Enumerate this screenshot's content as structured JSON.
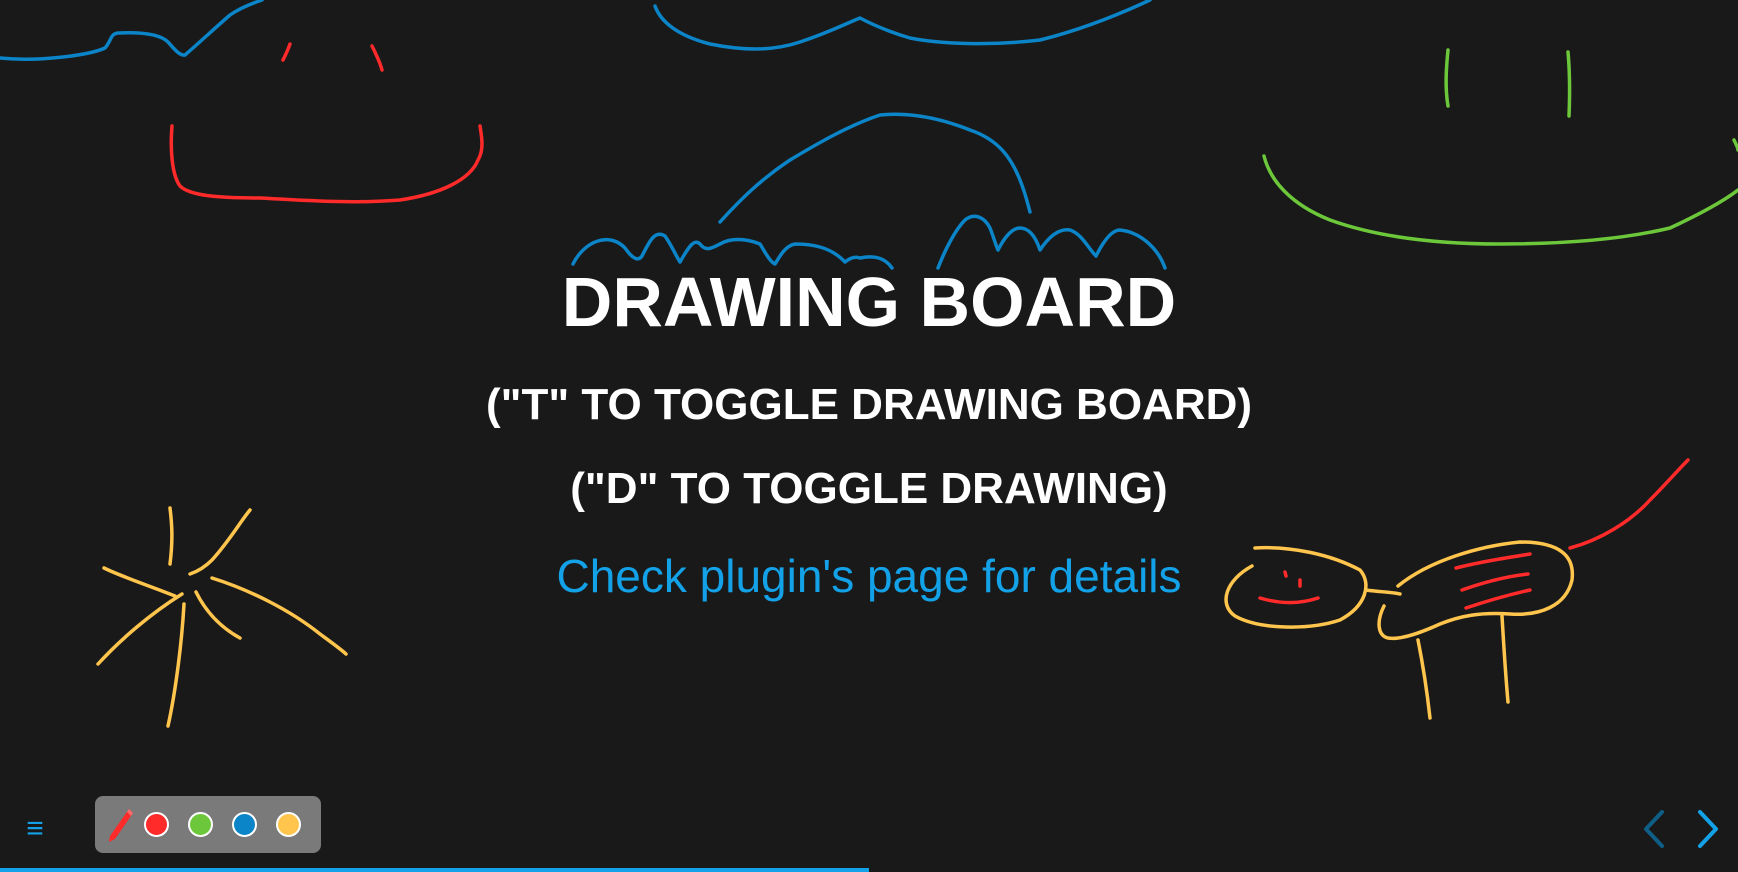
{
  "slide": {
    "title": "DRAWING BOARD",
    "line_toggle_board": "(\"T\" TO TOGGLE DRAWING BOARD)",
    "line_toggle_drawing": "(\"D\" TO TOGGLE DRAWING)",
    "link_text": "Check plugin's page for details"
  },
  "menu": {
    "icon": "hamburger-icon",
    "glyph": "≡"
  },
  "toolbar": {
    "pen_icon": "pen-icon",
    "swatches": [
      {
        "name": "red",
        "color": "#ff2a2a"
      },
      {
        "name": "green",
        "color": "#6cc83a"
      },
      {
        "name": "blue",
        "color": "#0b84c8"
      },
      {
        "name": "yellow",
        "color": "#ffc54d"
      }
    ]
  },
  "navigation": {
    "prev_icon": "chevron-left-icon",
    "next_icon": "chevron-right-icon"
  },
  "progress": {
    "fraction": 0.5
  },
  "colors": {
    "background": "#191919",
    "accent": "#13a2e8",
    "text": "#ffffff"
  }
}
